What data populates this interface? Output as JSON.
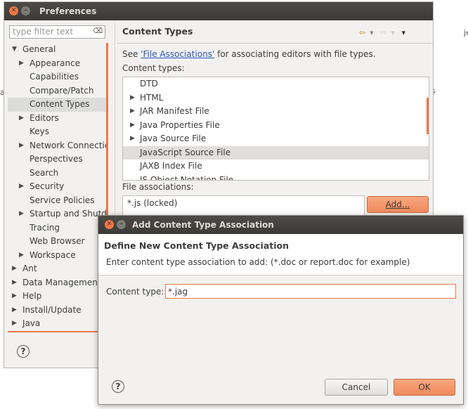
{
  "background": {
    "frag1": "je",
    "frag2": "a",
    "frag3": "s"
  },
  "preferences": {
    "title": "Preferences",
    "filter_placeholder": "type filter text",
    "tree": [
      {
        "label": "General",
        "level": 0,
        "arrow": "expanded"
      },
      {
        "label": "Appearance",
        "level": 1,
        "arrow": "collapsed"
      },
      {
        "label": "Capabilities",
        "level": 1,
        "arrow": ""
      },
      {
        "label": "Compare/Patch",
        "level": 1,
        "arrow": ""
      },
      {
        "label": "Content Types",
        "level": 1,
        "arrow": "",
        "selected": true
      },
      {
        "label": "Editors",
        "level": 1,
        "arrow": "collapsed"
      },
      {
        "label": "Keys",
        "level": 1,
        "arrow": ""
      },
      {
        "label": "Network Connection",
        "level": 1,
        "arrow": "collapsed"
      },
      {
        "label": "Perspectives",
        "level": 1,
        "arrow": ""
      },
      {
        "label": "Search",
        "level": 1,
        "arrow": ""
      },
      {
        "label": "Security",
        "level": 1,
        "arrow": "collapsed"
      },
      {
        "label": "Service Policies",
        "level": 1,
        "arrow": ""
      },
      {
        "label": "Startup and Shutdown",
        "level": 1,
        "arrow": "collapsed"
      },
      {
        "label": "Tracing",
        "level": 1,
        "arrow": ""
      },
      {
        "label": "Web Browser",
        "level": 1,
        "arrow": ""
      },
      {
        "label": "Workspace",
        "level": 1,
        "arrow": "collapsed"
      },
      {
        "label": "Ant",
        "level": 0,
        "arrow": "collapsed"
      },
      {
        "label": "Data Management",
        "level": 0,
        "arrow": "collapsed"
      },
      {
        "label": "Help",
        "level": 0,
        "arrow": "collapsed"
      },
      {
        "label": "Install/Update",
        "level": 0,
        "arrow": "collapsed"
      },
      {
        "label": "Java",
        "level": 0,
        "arrow": "collapsed"
      }
    ],
    "help_glyph": "?",
    "page_title": "Content Types",
    "nav": {
      "back": "⇦",
      "back_menu": "▾",
      "forward": "⇨",
      "forward_menu": "▾",
      "view_menu": "▾"
    },
    "see_prefix": "See ",
    "see_link": "'File Associations'",
    "see_suffix": " for associating editors with file types.",
    "content_types_label": "Content types:",
    "content_types": [
      {
        "label": "DTD",
        "expandable": false
      },
      {
        "label": "HTML",
        "expandable": true
      },
      {
        "label": "JAR Manifest File",
        "expandable": true
      },
      {
        "label": "Java Properties File",
        "expandable": true
      },
      {
        "label": "Java Source File",
        "expandable": true
      },
      {
        "label": "JavaScript Source File",
        "expandable": false,
        "selected": true
      },
      {
        "label": "JAXB Index File",
        "expandable": false
      },
      {
        "label": "JS Object Notation File",
        "expandable": false
      }
    ],
    "file_assoc_label": "File associations:",
    "file_assoc_items": [
      "*.js (locked)"
    ],
    "add_button": "Add..."
  },
  "dialog": {
    "title": "Add Content Type Association",
    "heading": "Define New Content Type Association",
    "description": "Enter content type association to add: (*.doc or report.doc for example)",
    "content_type_label": "Content type:",
    "content_type_value": "*.jag",
    "help_glyph": "?",
    "cancel": "Cancel",
    "ok": "OK"
  },
  "colors": {
    "accent": "#f07746",
    "titlebar": "#3b3a36",
    "link": "#2f57b8"
  }
}
